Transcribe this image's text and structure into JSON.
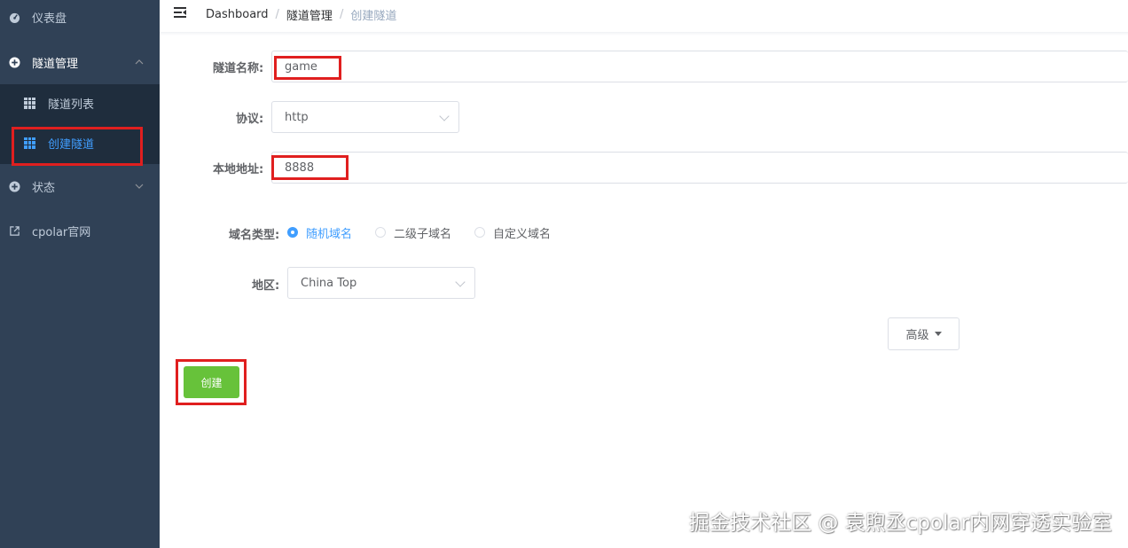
{
  "sidebar": {
    "items": [
      {
        "label": "仪表盘",
        "icon": "dashboard-icon"
      },
      {
        "label": "隧道管理",
        "icon": "plus-circle-icon"
      },
      {
        "label": "状态",
        "icon": "plus-circle-icon"
      },
      {
        "label": "cpolar官网",
        "icon": "external-link-icon"
      }
    ],
    "submenu": [
      {
        "label": "隧道列表",
        "icon": "grid-icon"
      },
      {
        "label": "创建隧道",
        "icon": "grid-icon",
        "active": true
      }
    ],
    "colors": {
      "background": "#304156",
      "submenu_background": "#1f2d3d",
      "active": "#409eff"
    }
  },
  "header": {
    "breadcrumb": [
      "Dashboard",
      "隧道管理",
      "创建隧道"
    ],
    "separator": "/"
  },
  "form": {
    "name_label": "隧道名称:",
    "name_value": "game",
    "protocol_label": "协议:",
    "protocol_value": "http",
    "local_label": "本地地址:",
    "local_value": "8888",
    "domain_type_label": "域名类型:",
    "domain_types": [
      "随机域名",
      "二级子域名",
      "自定义域名"
    ],
    "domain_type_selected": "随机域名",
    "region_label": "地区:",
    "region_value": "China Top",
    "advanced_label": "高级",
    "create_label": "创建"
  },
  "watermark": "掘金技术社区 @ 袁煦丞cpolar内网穿透实验室",
  "colors": {
    "primary": "#409eff",
    "success": "#67c23a",
    "highlight": "#e01f1f"
  }
}
